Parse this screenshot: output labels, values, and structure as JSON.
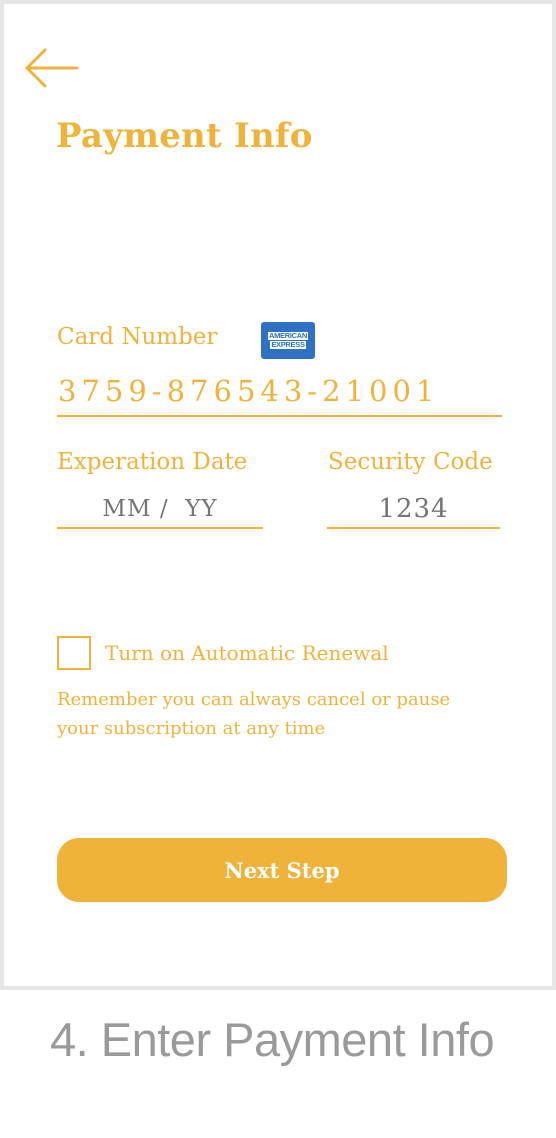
{
  "screen": {
    "title": "Payment Info",
    "back_icon": "arrow-left-icon"
  },
  "card": {
    "label": "Card Number",
    "brand_icon": "american-express-icon",
    "brand_text_line1": "AMERICAN",
    "brand_text_line2": "EXPRESS",
    "number": "3759-876543-21001"
  },
  "expiration": {
    "label": "Experation Date",
    "placeholder": "MM /  YY"
  },
  "security": {
    "label": "Security Code",
    "placeholder": "1234"
  },
  "renewal": {
    "checked": false,
    "label": "Turn on Automatic Renewal",
    "note_line1": "Remember you can always cancel or pause",
    "note_line2": "your subscription at any time"
  },
  "next_button": {
    "label": "Next Step"
  },
  "caption": "4. Enter Payment Info",
  "colors": {
    "accent": "#f0b33a",
    "amex_blue": "#2f72c4",
    "caption_gray": "#9a9a9a",
    "frame_border": "#e6e6e6"
  }
}
